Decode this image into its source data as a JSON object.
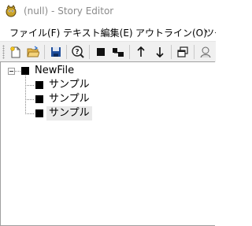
{
  "window": {
    "title": "(null) - Story Editor"
  },
  "menubar": {
    "items": [
      {
        "label": "ファイル(F)"
      },
      {
        "label": "テキスト編集(E)"
      },
      {
        "label": "アウトライン(O)"
      },
      {
        "label": "ツー"
      }
    ]
  },
  "toolbar": {
    "buttons": [
      {
        "icon": "new-file-icon"
      },
      {
        "icon": "open-folder-icon"
      },
      {
        "icon": "save-icon"
      },
      {
        "icon": "help-icon"
      },
      {
        "icon": "add-node-icon"
      },
      {
        "icon": "add-child-node-icon"
      },
      {
        "icon": "move-up-icon"
      },
      {
        "icon": "move-down-icon"
      },
      {
        "icon": "windows-icon"
      },
      {
        "icon": "user-icon"
      }
    ]
  },
  "tree": {
    "root": {
      "label": "NewFile",
      "expanded": true
    },
    "children": [
      {
        "label": "サンプル"
      },
      {
        "label": "サンプル"
      },
      {
        "label": "サンプル",
        "selected": true
      }
    ]
  },
  "colors": {
    "toolbar_bg": "#f0f0f0",
    "save_blue": "#1f4e9c",
    "folder_yellow": "#e8b84a",
    "selection_gray": "#e9e9e9"
  }
}
